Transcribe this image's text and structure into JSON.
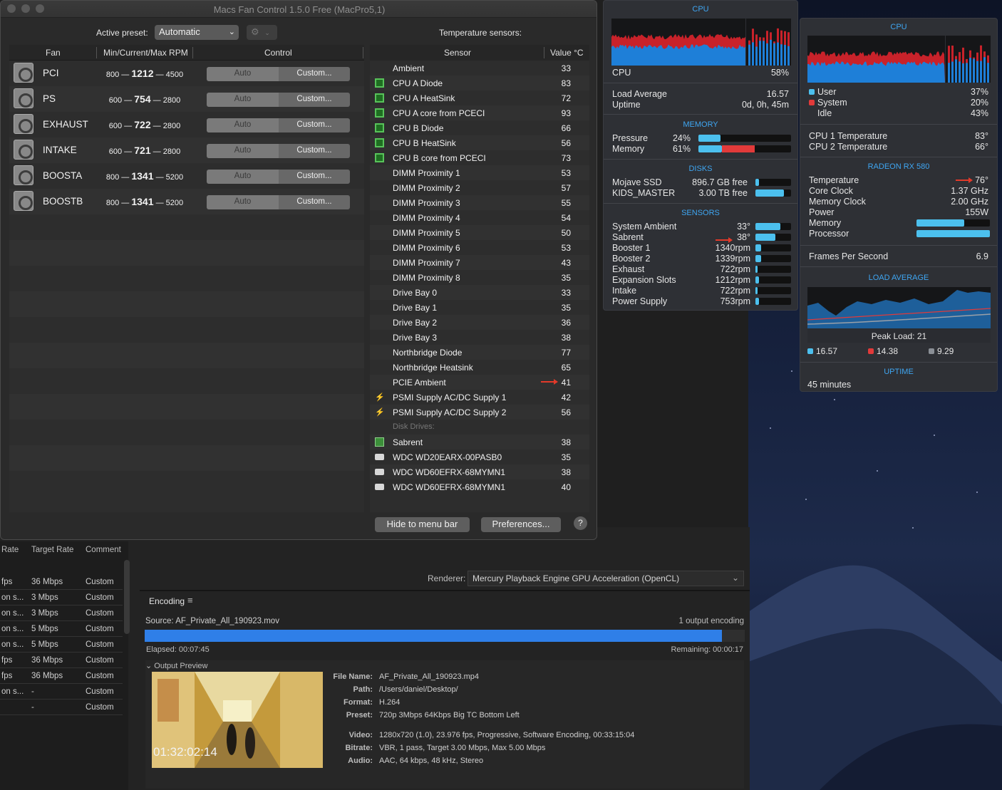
{
  "fan_window": {
    "title": "Macs Fan Control 1.5.0 Free (MacPro5,1)",
    "preset_label": "Active preset:",
    "preset_value": "Automatic",
    "gear_symbol": "⚙",
    "temps_label": "Temperature sensors:",
    "cols": {
      "fan": "Fan",
      "rpm": "Min/Current/Max RPM",
      "control": "Control",
      "sensor": "Sensor",
      "value": "Value °C"
    },
    "fans": [
      {
        "name": "PCI",
        "min": "800",
        "cur": "1212",
        "max": "4500",
        "auto": "Auto",
        "custom": "Custom..."
      },
      {
        "name": "PS",
        "min": "600",
        "cur": "754",
        "max": "2800",
        "auto": "Auto",
        "custom": "Custom..."
      },
      {
        "name": "EXHAUST",
        "min": "600",
        "cur": "722",
        "max": "2800",
        "auto": "Auto",
        "custom": "Custom..."
      },
      {
        "name": "INTAKE",
        "min": "600",
        "cur": "721",
        "max": "2800",
        "auto": "Auto",
        "custom": "Custom..."
      },
      {
        "name": "BOOSTA",
        "min": "800",
        "cur": "1341",
        "max": "5200",
        "auto": "Auto",
        "custom": "Custom..."
      },
      {
        "name": "BOOSTB",
        "min": "800",
        "cur": "1341",
        "max": "5200",
        "auto": "Auto",
        "custom": "Custom..."
      }
    ],
    "sensors": [
      {
        "name": "Ambient",
        "value": "33",
        "icon": "none"
      },
      {
        "name": "CPU A Diode",
        "value": "83",
        "icon": "chip"
      },
      {
        "name": "CPU A HeatSink",
        "value": "72",
        "icon": "chip"
      },
      {
        "name": "CPU A core from PCECI",
        "value": "93",
        "icon": "chip"
      },
      {
        "name": "CPU B Diode",
        "value": "66",
        "icon": "chip"
      },
      {
        "name": "CPU B HeatSink",
        "value": "56",
        "icon": "chip"
      },
      {
        "name": "CPU B core from PCECI",
        "value": "73",
        "icon": "chip"
      },
      {
        "name": "DIMM Proximity 1",
        "value": "53",
        "icon": "none"
      },
      {
        "name": "DIMM Proximity 2",
        "value": "57",
        "icon": "none"
      },
      {
        "name": "DIMM Proximity 3",
        "value": "55",
        "icon": "none"
      },
      {
        "name": "DIMM Proximity 4",
        "value": "54",
        "icon": "none"
      },
      {
        "name": "DIMM Proximity 5",
        "value": "50",
        "icon": "none"
      },
      {
        "name": "DIMM Proximity 6",
        "value": "53",
        "icon": "none"
      },
      {
        "name": "DIMM Proximity 7",
        "value": "43",
        "icon": "none"
      },
      {
        "name": "DIMM Proximity 8",
        "value": "35",
        "icon": "none"
      },
      {
        "name": "Drive Bay 0",
        "value": "33",
        "icon": "none"
      },
      {
        "name": "Drive Bay 1",
        "value": "35",
        "icon": "none"
      },
      {
        "name": "Drive Bay 2",
        "value": "36",
        "icon": "none"
      },
      {
        "name": "Drive Bay 3",
        "value": "38",
        "icon": "none"
      },
      {
        "name": "Northbridge Diode",
        "value": "77",
        "icon": "none"
      },
      {
        "name": "Northbridge Heatsink",
        "value": "65",
        "icon": "none"
      },
      {
        "name": "PCIE Ambient",
        "value": "41",
        "icon": "none",
        "arrow": true
      },
      {
        "name": "PSMI Supply AC/DC Supply 1",
        "value": "42",
        "icon": "bolt"
      },
      {
        "name": "PSMI Supply AC/DC Supply 2",
        "value": "56",
        "icon": "bolt"
      },
      {
        "name": "Disk Drives:",
        "value": "",
        "icon": "sub"
      },
      {
        "name": "Sabrent",
        "value": "38",
        "icon": "ssd"
      },
      {
        "name": "WDC WD20EARX-00PASB0",
        "value": "35",
        "icon": "disk"
      },
      {
        "name": "WDC WD60EFRX-68MYMN1",
        "value": "38",
        "icon": "disk"
      },
      {
        "name": "WDC WD60EFRX-68MYMN1",
        "value": "40",
        "icon": "disk"
      }
    ],
    "btn_hide": "Hide to menu bar",
    "btn_prefs": "Preferences...",
    "btn_help": "?"
  },
  "istat1": {
    "cpu_title": "CPU",
    "cpu_label": "CPU",
    "cpu_value": "58%",
    "load_label": "Load Average",
    "load_value": "16.57",
    "uptime_label": "Uptime",
    "uptime_value": "0d, 0h, 45m",
    "memory_title": "MEMORY",
    "pressure_label": "Pressure",
    "pressure_value": "24%",
    "pressure_level": 0.24,
    "memory_label": "Memory",
    "memory_value": "61%",
    "disks_title": "DISKS",
    "disks": [
      {
        "name": "Mojave SSD",
        "value": "896.7 GB free",
        "level": 0.1
      },
      {
        "name": "KIDS_MASTER",
        "value": "3.00 TB free",
        "level": 0.8
      }
    ],
    "sensors_title": "SENSORS",
    "sensors": [
      {
        "name": "System Ambient",
        "value": "33°",
        "level": 0.7
      },
      {
        "name": "Sabrent",
        "value": "38°",
        "level": 0.55,
        "arrow": true
      },
      {
        "name": "Booster 1",
        "value": "1340rpm",
        "level": 0.15
      },
      {
        "name": "Booster 2",
        "value": "1339rpm",
        "level": 0.15
      },
      {
        "name": "Exhaust",
        "value": "722rpm",
        "level": 0.06
      },
      {
        "name": "Expansion Slots",
        "value": "1212rpm",
        "level": 0.1
      },
      {
        "name": "Intake",
        "value": "722rpm",
        "level": 0.06
      },
      {
        "name": "Power Supply",
        "value": "753rpm",
        "level": 0.1
      }
    ]
  },
  "istat2": {
    "cpu_title": "CPU",
    "user_label": "User",
    "user_value": "37%",
    "system_label": "System",
    "system_value": "20%",
    "idle_label": "Idle",
    "idle_value": "43%",
    "cpu1_label": "CPU 1 Temperature",
    "cpu1_value": "83°",
    "cpu2_label": "CPU 2 Temperature",
    "cpu2_value": "66°",
    "gpu_title": "RADEON RX 580",
    "gpu_rows": [
      {
        "name": "Temperature",
        "value": "76°"
      },
      {
        "name": "Core Clock",
        "value": "1.37 GHz"
      },
      {
        "name": "Memory Clock",
        "value": "2.00 GHz"
      },
      {
        "name": "Power",
        "value": "155W"
      },
      {
        "name": "Memory",
        "value": "",
        "level": 0.65
      },
      {
        "name": "Processor",
        "value": "",
        "level": 1.0
      }
    ],
    "fps_label": "Frames Per Second",
    "fps_value": "6.9",
    "load_title": "LOAD AVERAGE",
    "peak_label": "Peak Load: 21",
    "load1": "16.57",
    "load5": "14.38",
    "load15": "9.29",
    "uptime_title": "UPTIME",
    "uptime_value": "45 minutes"
  },
  "encoder": {
    "cols": {
      "rate": "Rate",
      "target": "Target Rate",
      "comment": "Comment"
    },
    "rows": [
      {
        "rate": "fps",
        "target": "36 Mbps",
        "comment": "Custom"
      },
      {
        "rate": "on s...",
        "target": "3 Mbps",
        "comment": "Custom"
      },
      {
        "rate": "on s...",
        "target": "3 Mbps",
        "comment": "Custom"
      },
      {
        "rate": "on s...",
        "target": "5 Mbps",
        "comment": "Custom"
      },
      {
        "rate": "on s...",
        "target": "5 Mbps",
        "comment": "Custom"
      },
      {
        "rate": "fps",
        "target": "36 Mbps",
        "comment": "Custom"
      },
      {
        "rate": "fps",
        "target": "36 Mbps",
        "comment": "Custom"
      },
      {
        "rate": "on s...",
        "target": "-",
        "comment": "Custom"
      },
      {
        "rate": "",
        "target": "-",
        "comment": "Custom"
      }
    ],
    "renderer_label": "Renderer:",
    "renderer_value": "Mercury Playback Engine GPU Acceleration (OpenCL)",
    "encoding_title": "Encoding",
    "source": "Source: AF_Private_All_190923.mov",
    "outputs": "1 output encoding",
    "progress": 0.962,
    "elapsed": "Elapsed: 00:07:45",
    "remaining": "Remaining: 00:00:17",
    "output_preview": "Output Preview",
    "timecode": "01:32:02:14",
    "info": [
      {
        "k": "File Name:",
        "v": "AF_Private_All_190923.mp4"
      },
      {
        "k": "Path:",
        "v": "/Users/daniel/Desktop/"
      },
      {
        "k": "Format:",
        "v": "H.264"
      },
      {
        "k": "Preset:",
        "v": "720p 3Mbps 64Kbps Big TC Bottom Left"
      },
      {
        "k": "Video:",
        "v": "1280x720 (1.0), 23.976 fps, Progressive, Software Encoding, 00:33:15:04"
      },
      {
        "k": "Bitrate:",
        "v": "VBR, 1 pass, Target 3.00 Mbps, Max 5.00 Mbps"
      },
      {
        "k": "Audio:",
        "v": "AAC, 64 kbps, 48 kHz, Stereo"
      }
    ]
  },
  "colors": {
    "accent": "#3fa6f2",
    "progress": "#2f7fe8",
    "cpu_user": "#1e7fd8",
    "cpu_system": "#e23a3a",
    "bar": "#4cc0ee"
  }
}
